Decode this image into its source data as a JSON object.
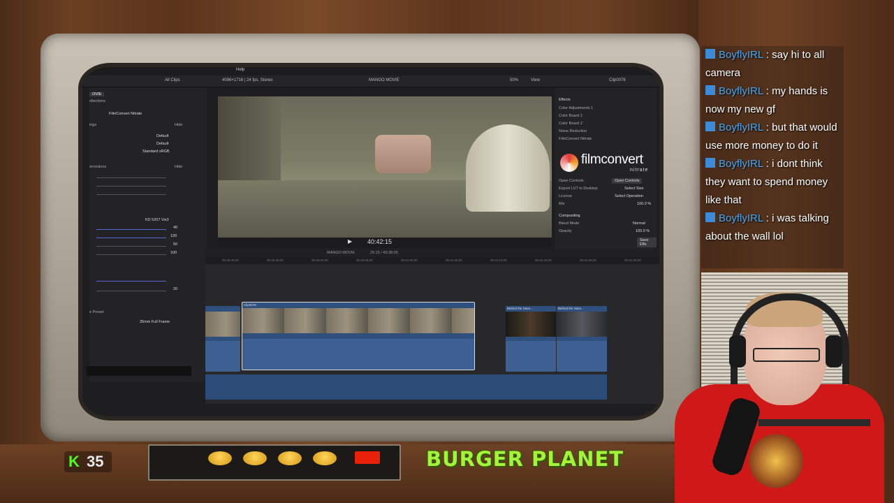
{
  "fcp": {
    "menu_help": "Help",
    "all_clips": "All Clips",
    "format": "4096×1716 | 24 fps, Stereo",
    "project": "MANGO MOVIE",
    "zoom": "50%",
    "view": "View",
    "clip_name": "Clip0076",
    "left_inspector": {
      "library": "OVIE",
      "collections": "ollections",
      "effect_title": "FilmConvert Nitrate",
      "settings": "ings",
      "default1": "Default",
      "default2": "Default",
      "standard": "Standard sRGB",
      "corrections": "orrections",
      "hide": "Hide",
      "film_stock": "KD 5207 Vis3",
      "val_40": "40",
      "val_130": "130",
      "val_50": "50",
      "val_100": "100",
      "val_20": "20",
      "preset": "e Preset",
      "preset_value": "35mm Full Frame"
    },
    "right_inspector": {
      "effects": "Effects",
      "color_adj": "Color Adjustments 1",
      "color_board2": "Color Board 2",
      "color_board": "Color Board 2",
      "noise": "Noise Reduction",
      "filmconvert": "FilmConvert Nitrate",
      "logo_text": "filmconvert",
      "logo_sub": "nitrate",
      "open_controls_label": "Open Controls",
      "open_controls_btn": "Open Controls",
      "export_lut": "Export LUT to Desktop",
      "select_size": "Select Size",
      "license": "License",
      "select_op": "Select Operation",
      "mix": "Mix",
      "mix_val": "100.0 %",
      "compositing": "Compositing",
      "blend_mode": "Blend Mode",
      "blend_val": "Normal",
      "opacity": "Opacity",
      "opacity_val": "100.0 %",
      "save_effects": "Save Effe"
    },
    "timecode": "40:42:15",
    "timeline_project": "MANGO MOVIE",
    "timeline_duration": "25:15 / 43:38:05",
    "ruler": [
      "00:40:40:00",
      "00:40:45:00",
      "00:40:50:00",
      "00:40:55:00",
      "00:41:00:00",
      "00:41:05:00",
      "00:41:10:00",
      "00:41:15:00",
      "00:41:20:00",
      "00:41:25:00"
    ],
    "clips": {
      "main": "Clip0076",
      "b1": "Behind the Stars...",
      "b2": "Behind the Stars..."
    }
  },
  "overlay": {
    "kick_icon": "K",
    "kick_count": "35",
    "title": "BURGER PLANET"
  },
  "chat": [
    {
      "user": "BoyflyIRL",
      "msg": " : say hi to all camera"
    },
    {
      "user": "BoyflyIRL",
      "msg": " : my hands is now my new gf"
    },
    {
      "user": "BoyflyIRL",
      "msg": " : but that would use more money to do it"
    },
    {
      "user": "BoyflyIRL",
      "msg": " : i dont think they want to spend money like that"
    },
    {
      "user": "BoyflyIRL",
      "msg": " : i was talking about the wall lol"
    }
  ],
  "colors": {
    "kick_green": "#53fc18",
    "title_green": "#a6f23a",
    "chat_user": "#4aa8f2",
    "shirt": "#d01818"
  }
}
